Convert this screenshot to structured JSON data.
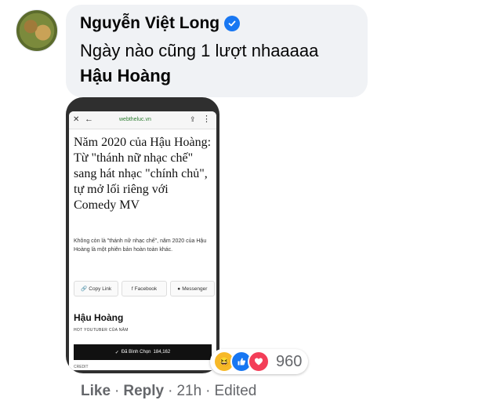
{
  "comment": {
    "author": "Nguyễn Việt Long",
    "verified_icon": "verified-badge-icon",
    "text": "Ngày nào cũng 1 lượt nhaaaaa",
    "mention": "Hậu Hoàng"
  },
  "attachment": {
    "url": "webtheluc.vn",
    "headline": "Năm 2020 của Hậu Hoàng: Từ \"thánh nữ nhạc chế\" sang hát nhạc \"chính chủ\", tự mở lối riêng với Comedy MV",
    "summary": "Không còn là \"thánh nữ nhạc chế\", năm 2020 của Hậu Hoàng là một phiên bản hoàn toàn khác.",
    "share_buttons": [
      "Copy Link",
      "Facebook",
      "Messenger"
    ],
    "person_name": "Hậu Hoàng",
    "person_title": "HOT YOUTUBER CỦA NĂM",
    "vote_label": "Đã Bình Chọn",
    "vote_count": "184,162",
    "credit": "CREDIT"
  },
  "reactions": {
    "icons": [
      "haha-reaction-icon",
      "like-reaction-icon",
      "love-reaction-icon"
    ],
    "count": "960"
  },
  "actions": {
    "like": "Like",
    "reply": "Reply",
    "time": "21h",
    "edited": "Edited"
  },
  "colors": {
    "bubble": "#f0f2f5",
    "verified": "#1877f2",
    "meta_text": "#65676b"
  }
}
